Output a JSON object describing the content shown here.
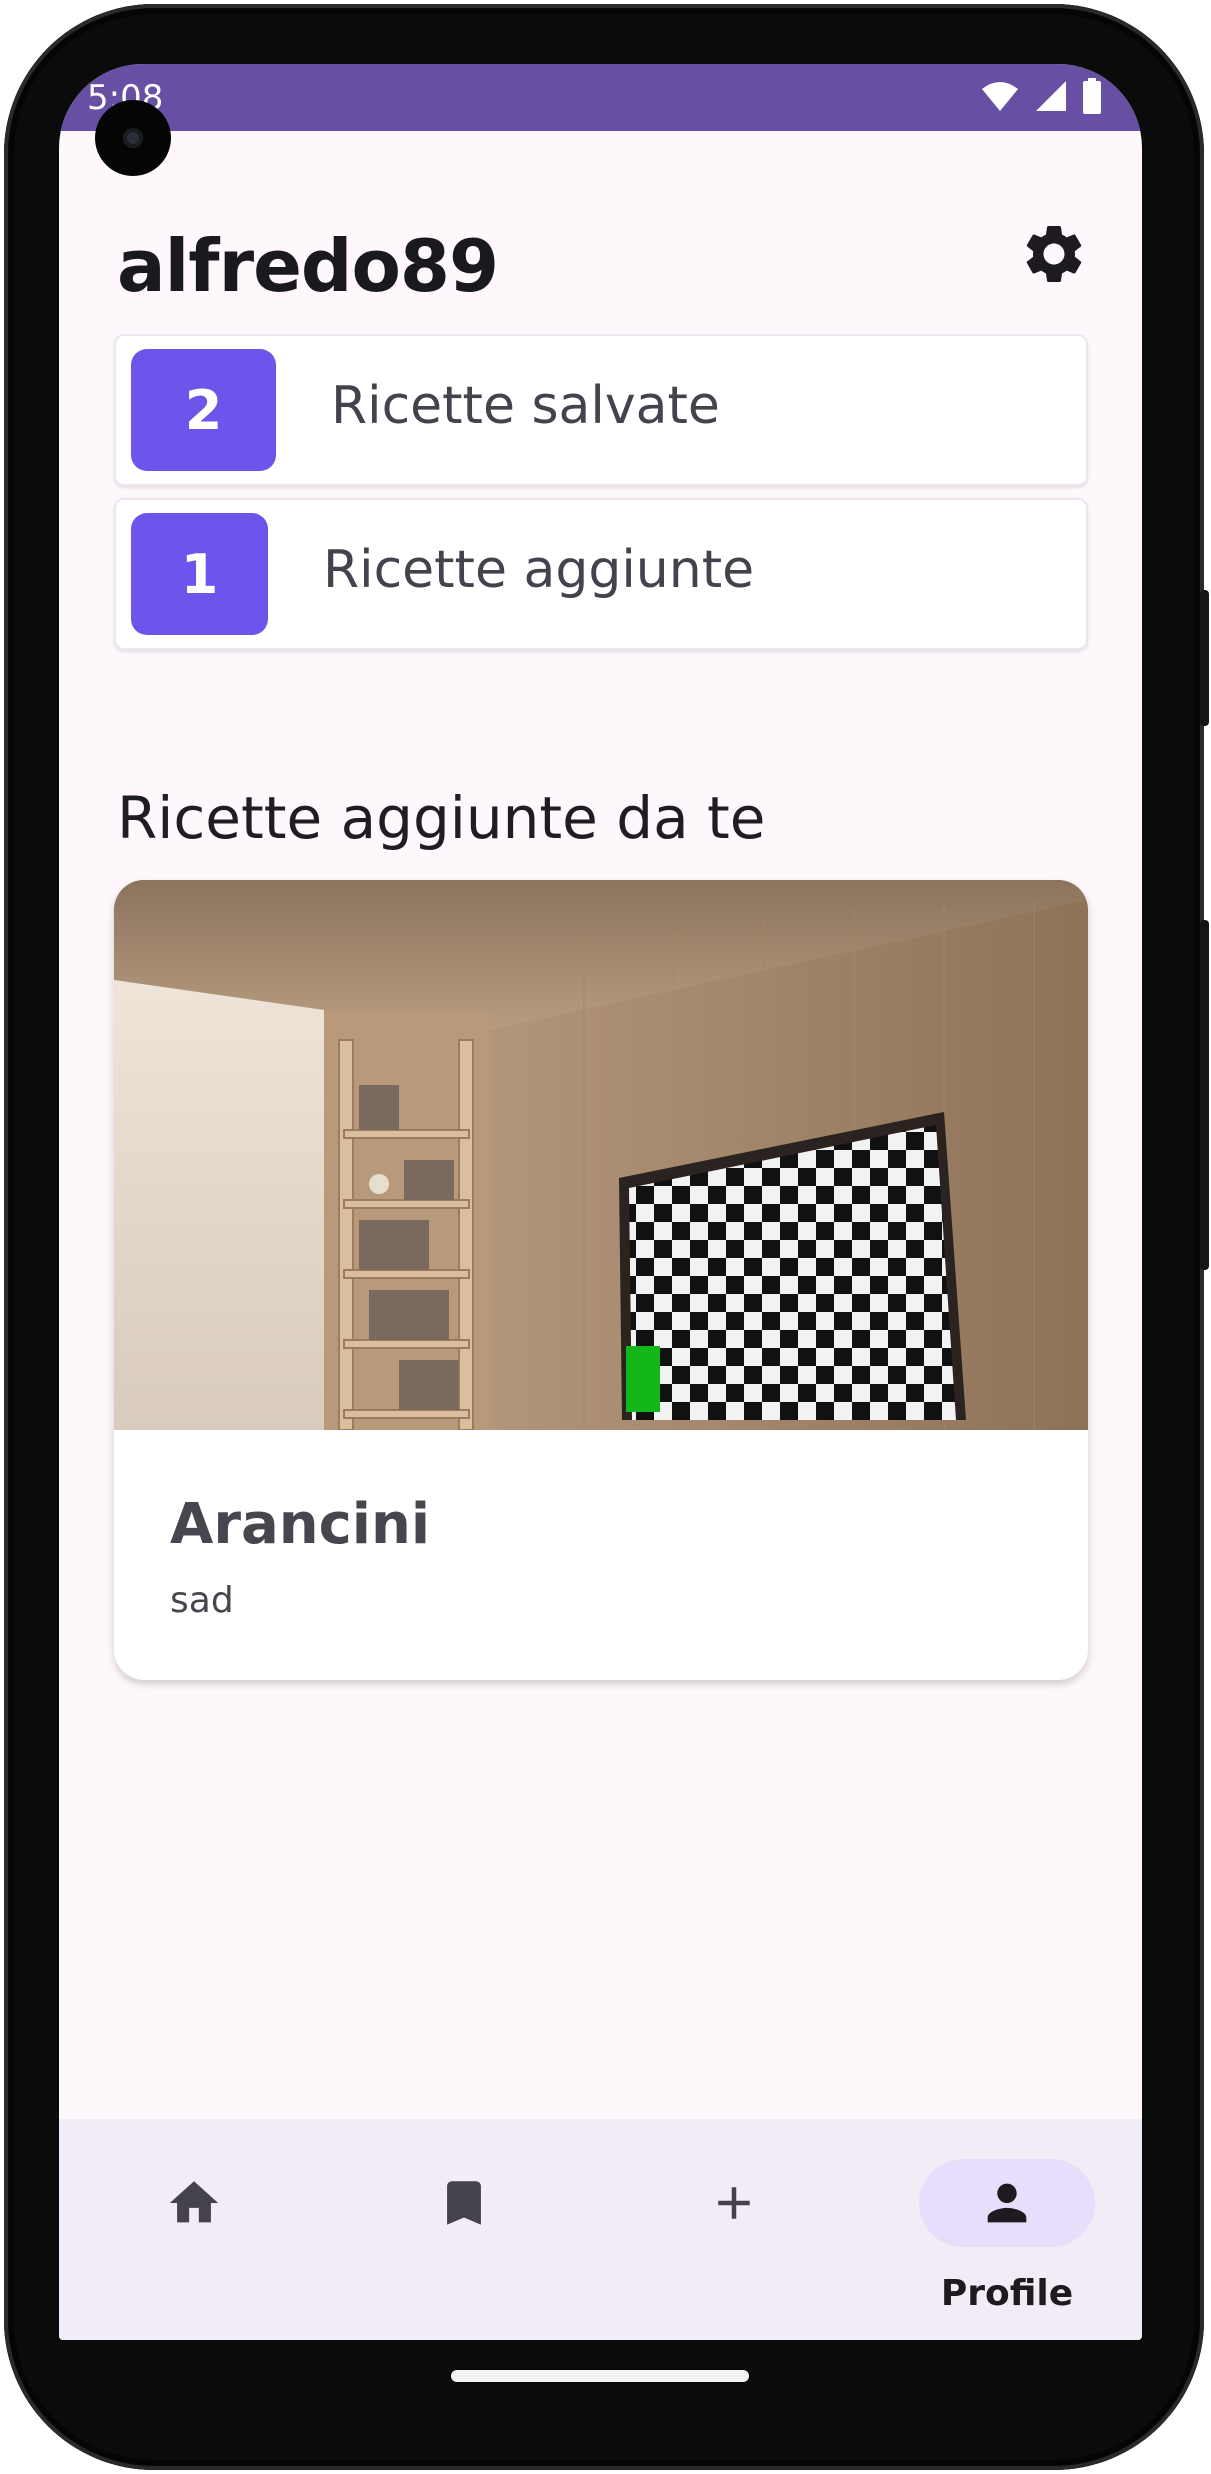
{
  "status_bar": {
    "time": "5:08",
    "icons": [
      "wifi-icon",
      "cell-signal-icon",
      "battery-icon"
    ],
    "color": "#6750a4"
  },
  "header": {
    "username": "alfredo89",
    "settings_icon": "gear-icon"
  },
  "stats": [
    {
      "count": "2",
      "label": "Ricette salvate"
    },
    {
      "count": "1",
      "label": "Ricette aggiunte"
    }
  ],
  "section": {
    "title": "Ricette aggiunte da te"
  },
  "recipes": [
    {
      "title": "Arancini",
      "description": "sad"
    }
  ],
  "bottom_nav": {
    "items": [
      {
        "icon": "home-icon",
        "label": ""
      },
      {
        "icon": "bookmark-icon",
        "label": ""
      },
      {
        "icon": "add-icon",
        "label": ""
      },
      {
        "icon": "person-icon",
        "label": "Profile",
        "active": true
      }
    ]
  },
  "colors": {
    "accent": "#6c55ea",
    "background": "#fef7fb",
    "nav_background": "#f2ecf7",
    "active_indicator": "#e8ddfa"
  }
}
